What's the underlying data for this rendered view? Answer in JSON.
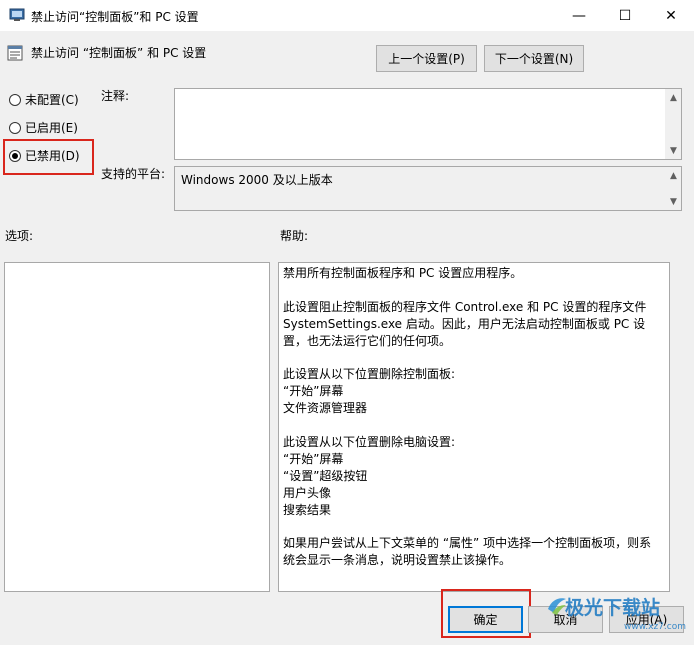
{
  "window": {
    "title": "禁止访问“控制面板”和 PC 设置",
    "minimize_glyph": "—",
    "maximize_glyph": "☐",
    "close_glyph": "✕"
  },
  "header": {
    "policy_title": "禁止访问 “控制面板” 和 PC 设置",
    "prev_label": "上一个设置(P)",
    "next_label": "下一个设置(N)"
  },
  "state": {
    "options": [
      {
        "label": "未配置(C)",
        "checked": false
      },
      {
        "label": "已启用(E)",
        "checked": false
      },
      {
        "label": "已禁用(D)",
        "checked": true
      }
    ]
  },
  "comment": {
    "label": "注释:",
    "value": ""
  },
  "platform": {
    "label": "支持的平台:",
    "value": "Windows 2000 及以上版本"
  },
  "options_label": "选项:",
  "help": {
    "label": "帮助:",
    "paragraphs": [
      "禁用所有控制面板程序和 PC 设置应用程序。",
      "此设置阻止控制面板的程序文件 Control.exe 和 PC 设置的程序文件 SystemSettings.exe 启动。因此，用户无法启动控制面板或 PC 设置，也无法运行它们的任何项。",
      "此设置从以下位置删除控制面板:\n“开始”屏幕\n文件资源管理器",
      "此设置从以下位置删除电脑设置:\n“开始”屏幕\n“设置”超级按钮\n用户头像\n搜索结果",
      "如果用户尝试从上下文菜单的 “属性” 项中选择一个控制面板项，则系统会显示一条消息，说明设置禁止该操作。"
    ]
  },
  "footer": {
    "ok_label": "确定",
    "cancel_label": "取消",
    "apply_label": "应用(A)"
  },
  "watermark": {
    "text": "极光下载站",
    "url": "www.xz7.com"
  },
  "colors": {
    "highlight": "#d9261c",
    "accent": "#0078d7"
  }
}
